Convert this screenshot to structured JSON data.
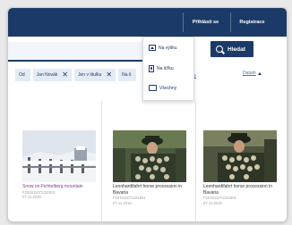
{
  "header": {
    "login_label": "Přihlásit se",
    "register_label": "Registrace"
  },
  "search": {
    "button_label": "Hledat"
  },
  "orientation_menu": {
    "items": [
      {
        "label": "Na výšku",
        "icon": "landscape-image-icon"
      },
      {
        "label": "Na šířku",
        "icon": "portrait-image-icon"
      },
      {
        "label": "Všechny",
        "icon": "all-formats-icon"
      }
    ]
  },
  "filters": {
    "chips": [
      {
        "label": "Od",
        "removable": false
      },
      {
        "label": "Jan Novák",
        "removable": true
      },
      {
        "label": "Jen v titulku",
        "removable": true
      },
      {
        "label": "Na š",
        "removable": false
      }
    ],
    "more_link": "filtry",
    "sort_label": "Datum"
  },
  "results": [
    {
      "title": "Snow on Fichtelberg mountain",
      "id": "F201611071152001",
      "date": "07.11.2016"
    },
    {
      "title": "Leonhardifahrt horse procession in Bavaria",
      "id": "F201611071151861",
      "date": "07.11.2016"
    },
    {
      "title": "Leonhardifahrt horse procession in Bavaria",
      "id": "F201611071151601",
      "date": "07.11.2016"
    }
  ],
  "colors": {
    "brand_navy": "#1b3a67",
    "link_blue": "#4a6fa5",
    "chip_bg": "#e3ecf5",
    "visited_title": "#7c3f8f"
  }
}
